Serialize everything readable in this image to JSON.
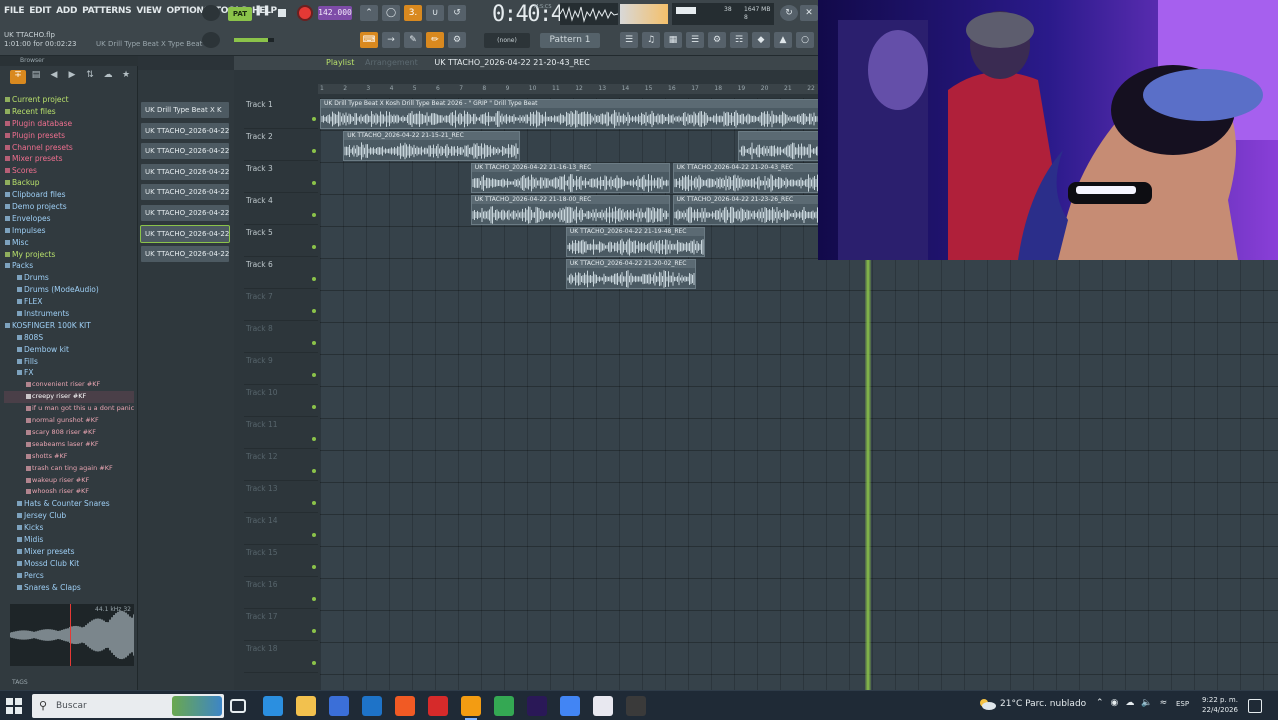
{
  "menu": [
    "FILE",
    "EDIT",
    "ADD",
    "PATTERNS",
    "VIEW",
    "OPTIONS",
    "TOOLS",
    "HELP"
  ],
  "project": {
    "name": "UK TTACHO.flp",
    "time_info": "1:01:00 for 00:02:23",
    "hint": "UK Drill Type Beat X Type Beat"
  },
  "transport": {
    "pattern_mode": "PAT",
    "tempo": "142.000",
    "song_time": "0:40:44",
    "time_label": "M:S:CS",
    "cpu_value": "38",
    "memory": "1647 MB",
    "polyphony": "8"
  },
  "toolbar": {
    "snap": "(none)",
    "pattern": "Pattern 1"
  },
  "browser": {
    "header": "Browser",
    "items": [
      {
        "label": "Current project",
        "kind": "folder"
      },
      {
        "label": "Recent files",
        "kind": "folder"
      },
      {
        "label": "Plugin database",
        "kind": "pink"
      },
      {
        "label": "Plugin presets",
        "kind": "pink"
      },
      {
        "label": "Channel presets",
        "kind": "pink"
      },
      {
        "label": "Mixer presets",
        "kind": "pink"
      },
      {
        "label": "Scores",
        "kind": "pink"
      },
      {
        "label": "Backup",
        "kind": "folder"
      },
      {
        "label": "Clipboard files",
        "kind": "blue"
      },
      {
        "label": "Demo projects",
        "kind": "blue"
      },
      {
        "label": "Envelopes",
        "kind": "blue"
      },
      {
        "label": "Impulses",
        "kind": "blue"
      },
      {
        "label": "Misc",
        "kind": "blue"
      },
      {
        "label": "My projects",
        "kind": "folder"
      },
      {
        "label": "Packs",
        "kind": "blue"
      },
      {
        "label": "Drums",
        "kind": "blue sub"
      },
      {
        "label": "Drums (ModeAudio)",
        "kind": "blue sub"
      },
      {
        "label": "FLEX",
        "kind": "blue sub"
      },
      {
        "label": "Instruments",
        "kind": "blue sub"
      },
      {
        "label": "KOSFINGER 100K KIT",
        "kind": "blue"
      },
      {
        "label": "808S",
        "kind": "blue sub"
      },
      {
        "label": "Dembow kit",
        "kind": "blue sub"
      },
      {
        "label": "Fills",
        "kind": "blue sub"
      },
      {
        "label": "FX",
        "kind": "blue sub"
      },
      {
        "label": "convenient riser #KF",
        "kind": "fx"
      },
      {
        "label": "creepy riser #KF",
        "kind": "fx sel"
      },
      {
        "label": "if u man got this u a dont panic #KF",
        "kind": "fx"
      },
      {
        "label": "normal gunshot #KF",
        "kind": "fx"
      },
      {
        "label": "scary 808 riser #KF",
        "kind": "fx"
      },
      {
        "label": "seabeams laser #KF",
        "kind": "fx"
      },
      {
        "label": "shotts #KF",
        "kind": "fx"
      },
      {
        "label": "trash can ting again #KF",
        "kind": "fx"
      },
      {
        "label": "wakeup riser #KF",
        "kind": "fx"
      },
      {
        "label": "whoosh riser #KF",
        "kind": "fx"
      },
      {
        "label": "Hats & Counter Snares",
        "kind": "blue sub"
      },
      {
        "label": "Jersey Club",
        "kind": "blue sub"
      },
      {
        "label": "Kicks",
        "kind": "blue sub"
      },
      {
        "label": "Midis",
        "kind": "blue sub"
      },
      {
        "label": "Mixer presets",
        "kind": "blue sub"
      },
      {
        "label": "Mossd Club Kit",
        "kind": "blue sub"
      },
      {
        "label": "Percs",
        "kind": "blue sub"
      },
      {
        "label": "Snares & Claps",
        "kind": "blue sub"
      }
    ],
    "preview_info": "44.1 kHz 32",
    "footer": "TAGS"
  },
  "picker": {
    "title": "",
    "clips": [
      "UK Drill Type Beat X K",
      "UK TTACHO_2026-04-22 2",
      "UK TTACHO_2026-04-22 2",
      "UK TTACHO_2026-04-22 2",
      "UK TTACHO_2026-04-22 2",
      "UK TTACHO_2026-04-22 2",
      "UK TTACHO_2026-04-22 2",
      "UK TTACHO_2026-04-22 2"
    ],
    "highlighted_index": 6
  },
  "playlist": {
    "name": "Playlist",
    "arrangement": "Arrangement",
    "file": "UK TTACHO_2026-04-22 21-20-43_REC",
    "ruler": [
      "1",
      "2",
      "3",
      "4",
      "5",
      "6",
      "7",
      "8",
      "9",
      "10",
      "11",
      "12",
      "13",
      "14",
      "15",
      "16",
      "17",
      "18",
      "19",
      "20",
      "21",
      "22"
    ],
    "tracks": [
      "Track 1",
      "Track 2",
      "Track 3",
      "Track 4",
      "Track 5",
      "Track 6",
      "Track 7",
      "Track 8",
      "Track 9",
      "Track 10",
      "Track 11",
      "Track 12",
      "Track 13",
      "Track 14",
      "Track 15",
      "Track 16",
      "Track 17",
      "Track 18"
    ],
    "clips": [
      {
        "track": 1,
        "start": 1.0,
        "length": 22.0,
        "label": "UK Drill Type Beat X Kosh Drill Type Beat 2026 - \" GRIP \" Drill Type Beat"
      },
      {
        "track": 2,
        "start": 2.0,
        "length": 7.6,
        "label": "UK TTACHO_2026-04-22 21-15-21_REC"
      },
      {
        "track": 2,
        "start": 19.0,
        "length": 4.0,
        "label": ""
      },
      {
        "track": 3,
        "start": 7.5,
        "length": 8.6,
        "label": "UK TTACHO_2026-04-22 21-16-13_REC"
      },
      {
        "track": 3,
        "start": 16.2,
        "length": 6.8,
        "label": "UK TTACHO_2026-04-22 21-20-43_REC"
      },
      {
        "track": 4,
        "start": 7.5,
        "length": 8.6,
        "label": "UK TTACHO_2026-04-22 21-18-00_REC"
      },
      {
        "track": 4,
        "start": 16.2,
        "length": 6.8,
        "label": "UK TTACHO_2026-04-22 21-23-26_REC"
      },
      {
        "track": 5,
        "start": 11.6,
        "length": 6.0,
        "label": "UK TTACHO_2026-04-22 21-19-48_REC"
      },
      {
        "track": 6,
        "start": 11.6,
        "length": 5.6,
        "label": "UK TTACHO_2026-04-22 21-20-02_REC"
      }
    ],
    "playhead_bar": 24.5
  },
  "taskbar": {
    "search_placeholder": "Buscar",
    "weather": "21°C  Parc. nublado",
    "language": "ESP",
    "time": "9:22 p. m.",
    "date": "22/4/2026",
    "apps": [
      "task-view",
      "edge",
      "file-explorer",
      "store",
      "outlook",
      "brave",
      "opera",
      "fl-studio",
      "chrome",
      "premiere",
      "chrome-alt",
      "media-player",
      "obs"
    ],
    "active_app": "fl-studio"
  },
  "colors": {
    "accent_green": "#8bc34a",
    "accent_orange": "#d9891f",
    "record_red": "#e53935",
    "grid": "#36424a",
    "clip": "#4b5a63"
  }
}
